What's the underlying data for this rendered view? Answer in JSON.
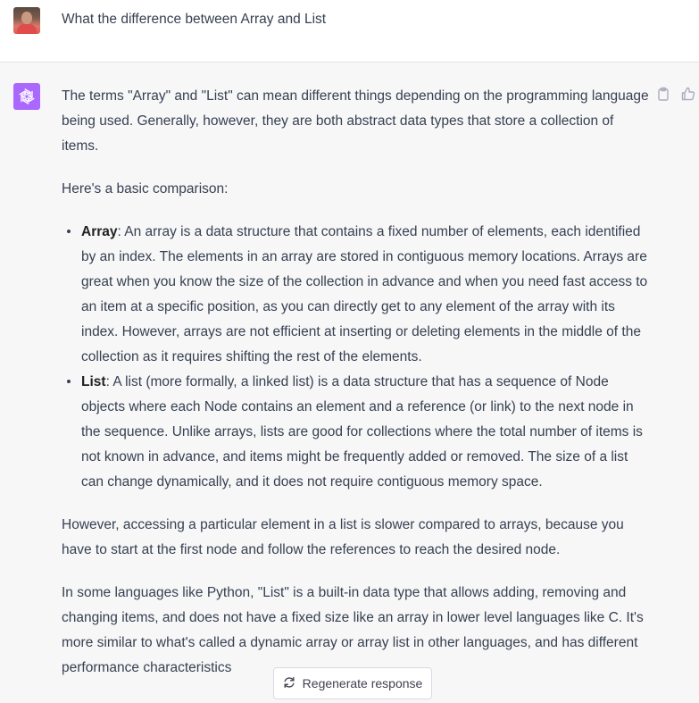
{
  "user_message": {
    "text": "What the difference between Array and List"
  },
  "assistant_message": {
    "intro": "The terms \"Array\" and \"List\" can mean different things depending on the programming language being used. Generally, however, they are both abstract data types that store a collection of items.",
    "comparison_lead": "Here's a basic comparison:",
    "bullets": [
      {
        "term": "Array",
        "text": ": An array is a data structure that contains a fixed number of elements, each identified by an index. The elements in an array are stored in contiguous memory locations. Arrays are great when you know the size of the collection in advance and when you need fast access to an item at a specific position, as you can directly get to any element of the array with its index. However, arrays are not efficient at inserting or deleting elements in the middle of the collection as it requires shifting the rest of the elements."
      },
      {
        "term": "List",
        "text": ": A list (more formally, a linked list) is a data structure that has a sequence of Node objects where each Node contains an element and a reference (or link) to the next node in the sequence. Unlike arrays, lists are good for collections where the total number of items is not known in advance, and items might be frequently added or removed. The size of a list can change dynamically, and it does not require contiguous memory space."
      }
    ],
    "access_note": "However, accessing a particular element in a list is slower compared to arrays, because you have to start at the first node and follow the references to reach the desired node.",
    "python_note": "In some languages like Python, \"List\" is a built-in data type that allows adding, removing and changing items, and does not have a fixed size like an array in lower level languages like C. It's more similar to what's called a dynamic array or array list in other languages, and has different performance characteristics"
  },
  "actions": {
    "regenerate_label": "Regenerate response",
    "copy_icon": "clipboard-icon",
    "thumbs_up_icon": "thumbs-up-icon"
  },
  "colors": {
    "assistant_avatar": "#ab68ff",
    "chat_background": "#f7f7f8",
    "text": "#374151"
  }
}
